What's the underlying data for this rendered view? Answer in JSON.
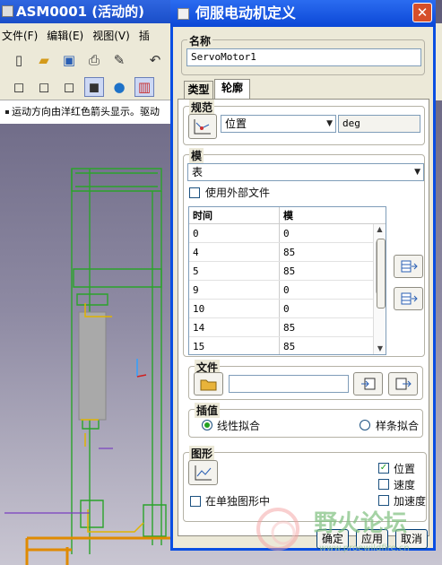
{
  "background_window": {
    "title": "ASM0001 (活动的)",
    "menu": [
      "文件(F)",
      "编辑(E)",
      "视图(V)",
      "插"
    ],
    "status_text": "运动方向由洋红色箭头显示。驱动"
  },
  "dialog": {
    "title": "伺服电动机定义",
    "close_label": "✕",
    "name_group_label": "名称",
    "name_value": "ServoMotor1",
    "tabs": [
      "类型",
      "轮廓"
    ],
    "spec_group_label": "规范",
    "spec_select": "位置",
    "spec_unit": "deg",
    "mode_group_label": "模",
    "mode_select": "表",
    "use_external_file_label": "使用外部文件",
    "table": {
      "headers": [
        "时间",
        "模"
      ],
      "rows": [
        [
          "0",
          "0"
        ],
        [
          "4",
          "85"
        ],
        [
          "5",
          "85"
        ],
        [
          "9",
          "0"
        ],
        [
          "10",
          "0"
        ],
        [
          "14",
          "85"
        ],
        [
          "15",
          "85"
        ]
      ]
    },
    "file_group_label": "文件",
    "file_value": "",
    "interp_group_label": "插值",
    "interp_options": [
      "线性拟合",
      "样条拟合"
    ],
    "interp_selected": "线性拟合",
    "graph_group_label": "图形",
    "separate_graph_label": "在单独图形中",
    "graph_checks": [
      {
        "label": "位置",
        "checked": true
      },
      {
        "label": "速度",
        "checked": false
      },
      {
        "label": "加速度",
        "checked": false
      }
    ],
    "buttons": {
      "ok": "确定",
      "apply": "应用",
      "cancel": "取消"
    }
  },
  "watermark": {
    "text": "野火论坛",
    "url": "www.proewildfire.cn"
  },
  "colors": {
    "dialog_border": "#0a4ee2",
    "title_bar": "#2b6cf0",
    "dialog_bg": "#ece9d8",
    "model_green": "#2ba32b",
    "check_green": "#21a121"
  }
}
